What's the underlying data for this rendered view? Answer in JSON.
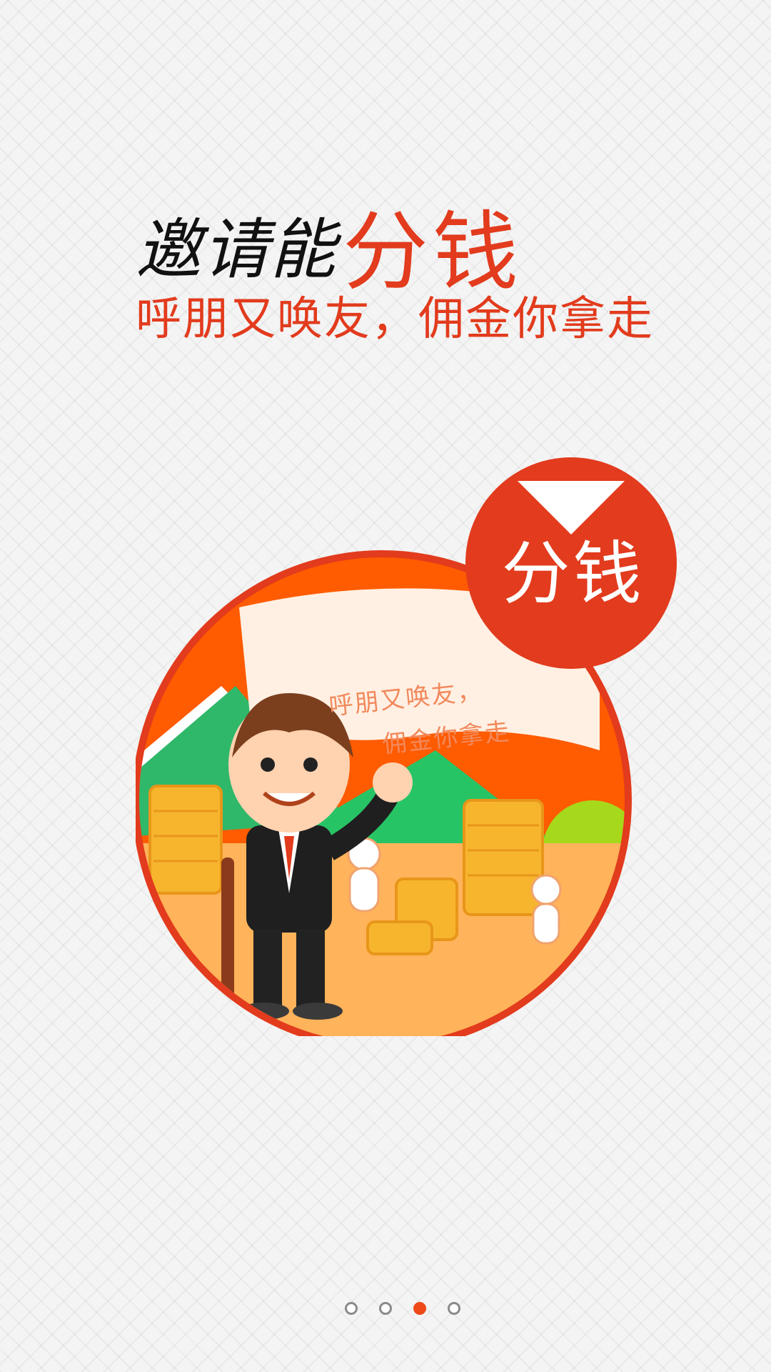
{
  "headline": {
    "lead": "邀请能",
    "accent": "分钱"
  },
  "subline": "呼朋又唤友，佣金你拿走",
  "illustration": {
    "flag_line1": "呼朋又唤友，",
    "flag_line2": "佣金你拿走",
    "badge_text": "分钱"
  },
  "pager": {
    "pages": 4,
    "active_index": 2
  },
  "colors": {
    "accent": "#e23b1d",
    "pager_active": "#ee4a19"
  }
}
